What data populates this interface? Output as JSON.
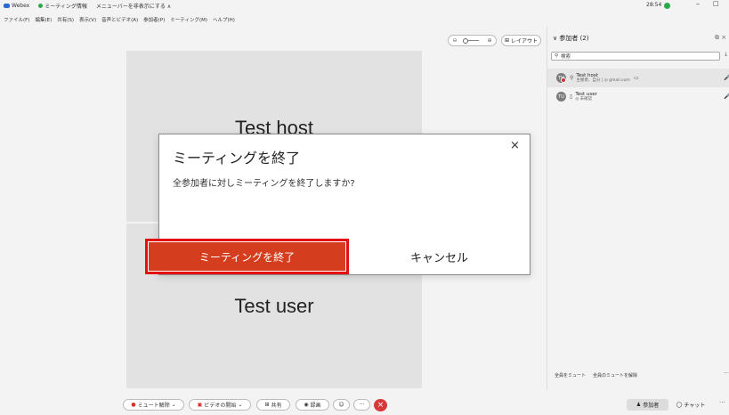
{
  "titlebar": {
    "app_name": "Webex",
    "meeting_info": "ミーティング情報",
    "menu_toggle": "メニューバーを非表示にする ∧",
    "time": "28:54",
    "minimize": "–",
    "maximize": "□"
  },
  "menubar": {
    "items": [
      "ファイル(F)",
      "編集(E)",
      "共有(S)",
      "表示(V)",
      "音声とビデオ(A)",
      "参加者(P)",
      "ミーティング(M)",
      "ヘルプ(H)"
    ]
  },
  "top_controls": {
    "zoom_out": "⊖",
    "zoom_in": "⊕",
    "layout_label": "レイアウト",
    "layout_icon": "⊞"
  },
  "video": {
    "host_name": "Test host",
    "user_name": "Test user"
  },
  "dialog": {
    "title": "ミーティングを終了",
    "message": "全参加者に対しミーティングを終了しますか?",
    "close": "×",
    "confirm_label": "ミーティングを終了",
    "cancel_label": "キャンセル",
    "highlight_color": "#e60f0f",
    "confirm_color": "#d43d1d"
  },
  "panel": {
    "header": "∨  参加者 (2)",
    "popout": "⧉ ×",
    "search_icon": "search-icon",
    "search_placeholder": "検索",
    "sort": "↓↑",
    "participants": [
      {
        "initials": "TH",
        "name": "Test host",
        "status": "主催者、自分 | ◎ gmail.com",
        "chat": "▭",
        "mic": "🎤"
      },
      {
        "initials": "TU",
        "name": "Test user",
        "status": "◎ 未確認",
        "mic": "🎤"
      }
    ],
    "mute_all": "全員をミュート",
    "unmute_all": "全員のミュートを解除",
    "more": "···"
  },
  "bottombar": {
    "mute": "ミュート解除",
    "video": "ビデオの開始",
    "share": "共有",
    "record": "録画",
    "reactions": "☺",
    "more": "···",
    "end": "×",
    "participants_tab": "参加者",
    "chat_tab": "チャット",
    "more_right": "···"
  }
}
